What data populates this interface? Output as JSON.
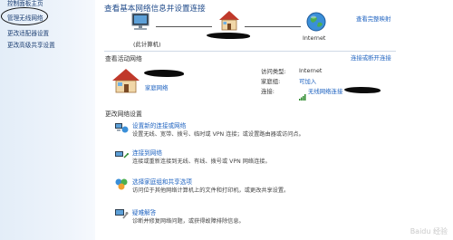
{
  "sidebar": {
    "items": [
      {
        "label": "控制面板主页"
      },
      {
        "label": "管理无线网络",
        "highlighted": true
      },
      {
        "label": "更改适配器设置"
      },
      {
        "label": "更改高级共享设置"
      }
    ]
  },
  "header": {
    "title": "查看基本网络信息并设置连接",
    "full_map_link": "查看完整映射"
  },
  "network_map": {
    "computer_label": "(此计算机)",
    "internet_label": "Internet",
    "icons": [
      "computer-icon",
      "house-icon",
      "globe-icon"
    ]
  },
  "active_networks": {
    "title": "查看活动网络",
    "connect_link": "连接或断开连接",
    "network_type_label": "家庭网络",
    "access_type_label": "访问类型:",
    "access_type_value": "Internet",
    "homegroup_label": "家庭组:",
    "homegroup_value": "可加入",
    "connection_label": "连接:",
    "connection_value": "无线网络连接"
  },
  "settings": {
    "title": "更改网络设置",
    "tasks": [
      {
        "title": "设置新的连接或网络",
        "desc": "设置无线、宽带、拨号、临时或 VPN 连接；或设置路由器或访问点。",
        "icon": "new-connection-icon"
      },
      {
        "title": "连接到网络",
        "desc": "连接或重新连接到无线、有线、拨号或 VPN 网络连接。",
        "icon": "connect-network-icon"
      },
      {
        "title": "选择家庭组和共享选项",
        "desc": "访问位于其他网络计算机上的文件和打印机，或更改共享设置。",
        "icon": "homegroup-icon"
      },
      {
        "title": "疑难解答",
        "desc": "诊断并修复网络问题，或获得故障排除信息。",
        "icon": "troubleshoot-icon"
      }
    ]
  },
  "watermark": "Baidu 经验"
}
